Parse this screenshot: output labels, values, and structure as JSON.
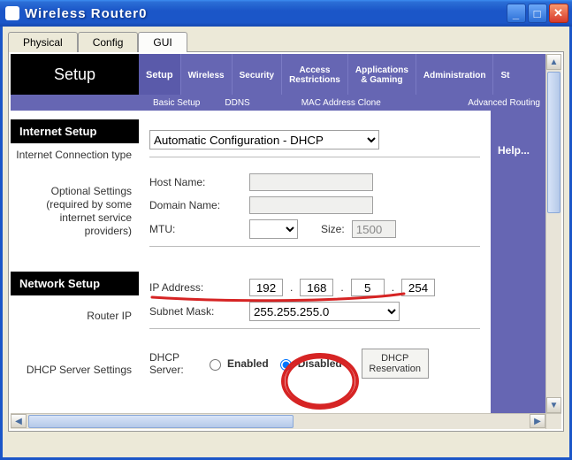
{
  "window": {
    "title": "Wireless Router0"
  },
  "tabs": {
    "items": [
      "Physical",
      "Config",
      "GUI"
    ],
    "active": 2
  },
  "setup_title": "Setup",
  "menu": [
    "Setup",
    "Wireless",
    "Security",
    "Access\nRestrictions",
    "Applications\n& Gaming",
    "Administration",
    "St"
  ],
  "submenu": [
    "Basic Setup",
    "DDNS",
    "MAC Address Clone",
    "Advanced Routing"
  ],
  "side": {
    "internet_setup": "Internet Setup",
    "internet_label": "Internet Connection type",
    "optional_label": "Optional Settings (required by some internet service providers)",
    "network_setup": "Network Setup",
    "router_ip": "Router IP",
    "dhcp_server_settings": "DHCP Server Settings"
  },
  "form": {
    "conn_type": "Automatic Configuration - DHCP",
    "host_label": "Host Name:",
    "domain_label": "Domain Name:",
    "mtu_label": "MTU:",
    "size_label": "Size:",
    "size_value": "1500",
    "ip_label": "IP Address:",
    "ip": [
      "192",
      "168",
      "5",
      "254"
    ],
    "subnet_label": "Subnet Mask:",
    "subnet_value": "255.255.255.0",
    "dhcp_server_label": "DHCP Server:",
    "dhcp_enabled": "Enabled",
    "dhcp_disabled": "Disabled",
    "dhcp_reservation": "DHCP Reservation"
  },
  "help_label": "Help..."
}
